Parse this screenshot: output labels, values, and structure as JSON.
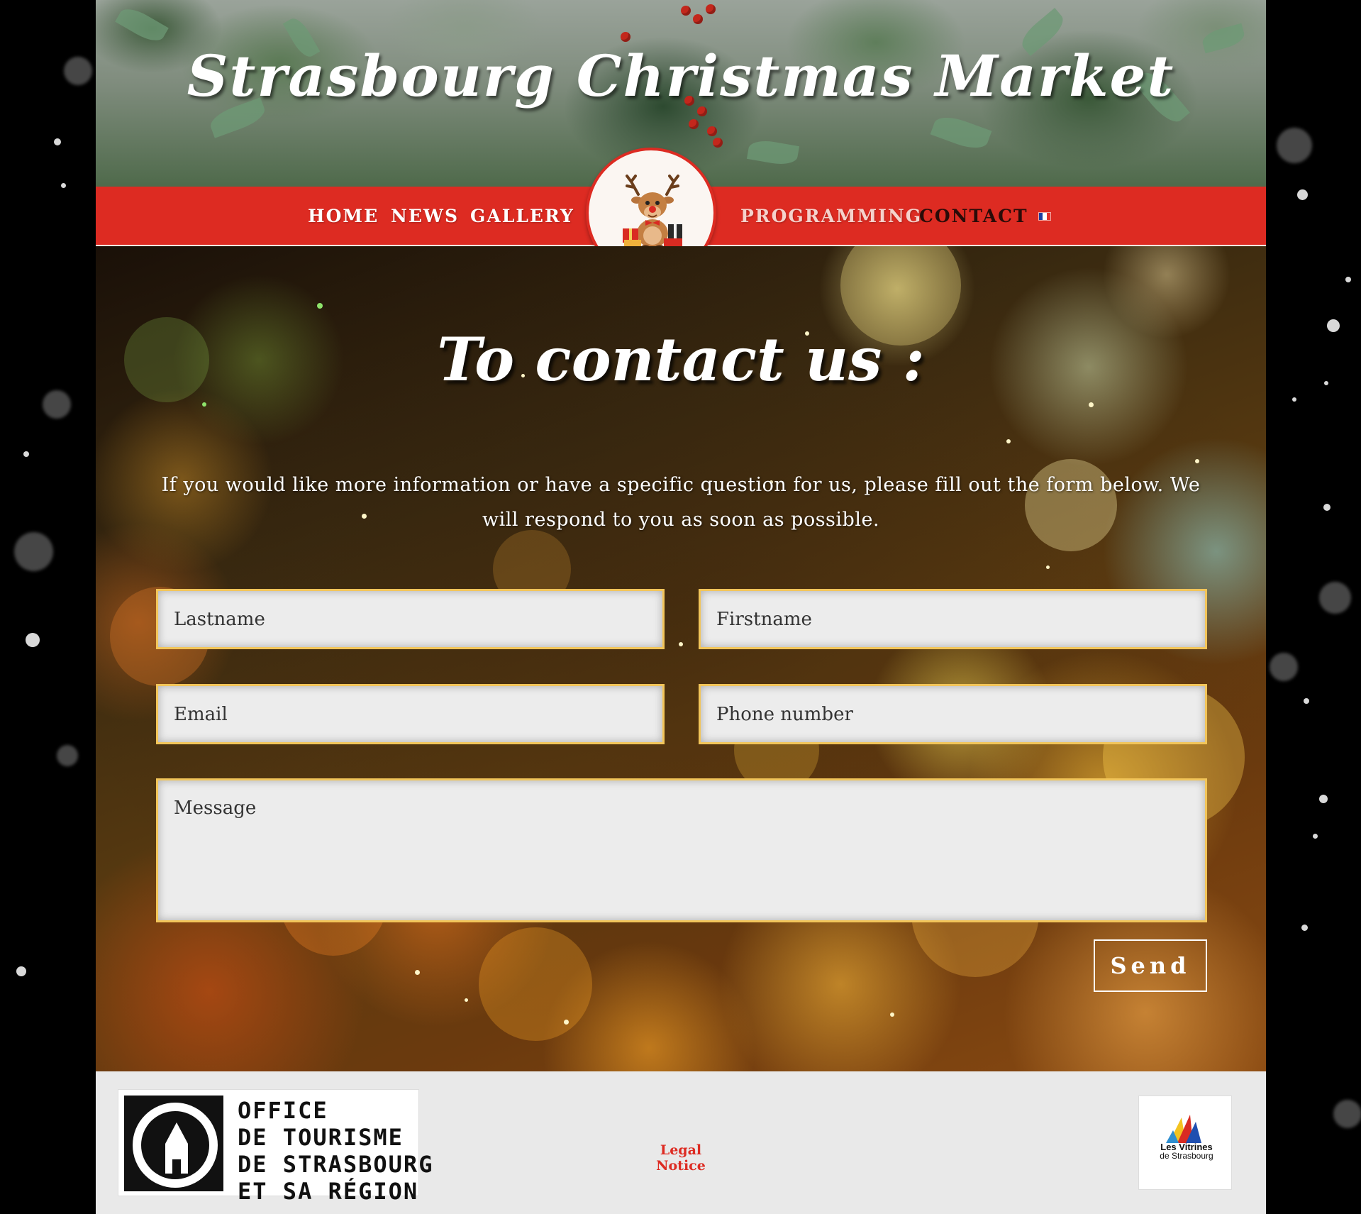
{
  "header": {
    "site_title": "Strasbourg Christmas Market"
  },
  "nav": {
    "items": [
      {
        "label": "HOME"
      },
      {
        "label": "NEWS"
      },
      {
        "label": "GALLERY"
      },
      {
        "label": "PROGRAMMING"
      },
      {
        "label": "CONTACT"
      }
    ],
    "active": "CONTACT",
    "language_icon": "french-flag-icon",
    "logo_icon": "reindeer-logo-icon"
  },
  "contact": {
    "title": "To contact us :",
    "intro": "If you would like more information or have a specific question for us, please fill out the form below. We will respond to you as soon as possible.",
    "form": {
      "lastname_placeholder": "Lastname",
      "firstname_placeholder": "Firstname",
      "email_placeholder": "Email",
      "phone_placeholder": "Phone number",
      "message_placeholder": "Message",
      "send_label": "Send"
    }
  },
  "footer": {
    "tourism_logo_lines": [
      "OFFICE",
      "DE TOURISME",
      "DE STRASBOURG",
      "ET SA RÉGION"
    ],
    "legal_link": "Legal Notice",
    "partner_logo_lines": [
      "Les Vitrines",
      "de Strasbourg"
    ]
  },
  "colors": {
    "nav_red": "#dd2b22",
    "field_border": "#f2c55a",
    "field_bg": "#ececec",
    "active_nav_text": "#2a0b08",
    "legal_link": "#dd2b22"
  }
}
